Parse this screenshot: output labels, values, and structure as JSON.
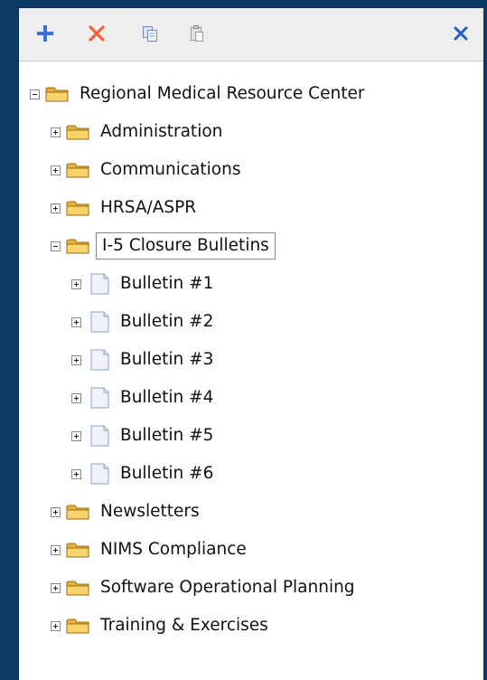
{
  "toolbar": {
    "add_icon": "plus-icon",
    "delete_icon": "delete-x-icon",
    "copy_icon": "copy-icon",
    "paste_icon": "paste-icon",
    "close_icon": "close-icon",
    "colors": {
      "add": "#3a6fd8",
      "delete": "#f0603a",
      "close": "#1f5fbf"
    }
  },
  "tree": {
    "root": {
      "label": "Regional Medical Resource Center",
      "expanded": true
    },
    "folders": [
      {
        "label": "Administration",
        "expanded": false
      },
      {
        "label": "Communications",
        "expanded": false
      },
      {
        "label": "HRSA/ASPR",
        "expanded": false
      },
      {
        "label": "I-5 Closure Bulletins",
        "expanded": true,
        "selected": true
      },
      {
        "label": "Newsletters",
        "expanded": false
      },
      {
        "label": "NIMS Compliance",
        "expanded": false
      },
      {
        "label": "Software Operational Planning",
        "expanded": false
      },
      {
        "label": "Training & Exercises",
        "expanded": false
      }
    ],
    "bulletins": [
      {
        "label": "Bulletin #1"
      },
      {
        "label": "Bulletin #2"
      },
      {
        "label": "Bulletin #3"
      },
      {
        "label": "Bulletin #4"
      },
      {
        "label": "Bulletin #5"
      },
      {
        "label": "Bulletin #6"
      }
    ]
  }
}
